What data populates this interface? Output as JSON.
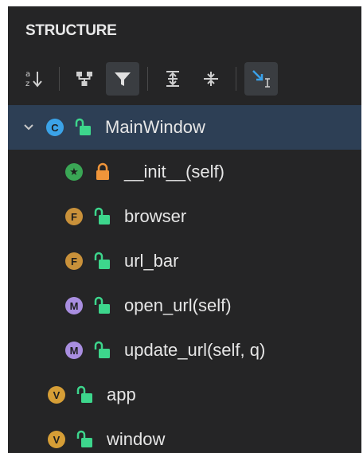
{
  "panel": {
    "title": "STRUCTURE"
  },
  "toolbar": {
    "buttons": [
      {
        "name": "sort-alpha-button",
        "icon": "sort-alphabetically-icon",
        "active": false
      },
      {
        "name": "group-by-button",
        "icon": "hierarchy-icon",
        "active": false
      },
      {
        "name": "filter-button",
        "icon": "filter-icon",
        "active": true
      },
      {
        "name": "expand-all-button",
        "icon": "expand-all-icon",
        "active": false
      },
      {
        "name": "collapse-all-button",
        "icon": "collapse-all-icon",
        "active": false
      },
      {
        "name": "autoscroll-button",
        "icon": "autoscroll-from-source-icon",
        "active": true
      }
    ]
  },
  "tree": {
    "items": [
      {
        "label": "MainWindow",
        "kind": "C",
        "kind_color": "#3ba3e8",
        "lock": "open",
        "lock_color": "#3dd68c",
        "expanded": true,
        "selected": true,
        "level": 0
      },
      {
        "label": "__init__(self)",
        "kind": "★",
        "kind_color": "#3aa655",
        "lock": "closed",
        "lock_color": "#f0953a",
        "level": 1
      },
      {
        "label": "browser",
        "kind": "F",
        "kind_color": "#c9913a",
        "lock": "open",
        "lock_color": "#3dd68c",
        "level": 1
      },
      {
        "label": "url_bar",
        "kind": "F",
        "kind_color": "#c9913a",
        "lock": "open",
        "lock_color": "#3dd68c",
        "level": 1
      },
      {
        "label": "open_url(self)",
        "kind": "M",
        "kind_color": "#a98ee0",
        "lock": "open",
        "lock_color": "#3dd68c",
        "level": 1
      },
      {
        "label": "update_url(self, q)",
        "kind": "M",
        "kind_color": "#a98ee0",
        "lock": "open",
        "lock_color": "#3dd68c",
        "level": 1
      },
      {
        "label": "app",
        "kind": "V",
        "kind_color": "#d69e36",
        "lock": "open",
        "lock_color": "#3dd68c",
        "level": 0
      },
      {
        "label": "window",
        "kind": "V",
        "kind_color": "#d69e36",
        "lock": "open",
        "lock_color": "#3dd68c",
        "level": 0
      }
    ]
  }
}
